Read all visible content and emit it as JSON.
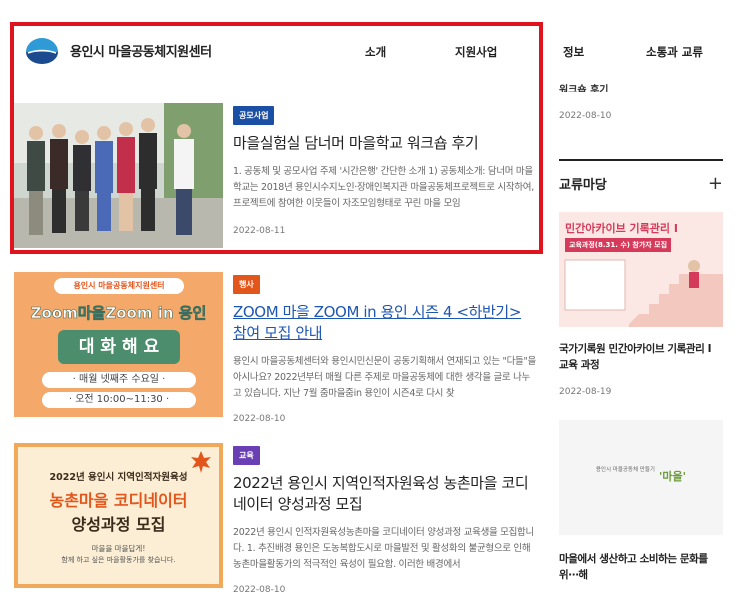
{
  "header": {
    "logo_text": "용인시 마을공동체지원센터",
    "nav": [
      "소개",
      "지원사업",
      "정보",
      "소통과 교류"
    ]
  },
  "articles": [
    {
      "badge": "공모사업",
      "badge_color": "#1a4fa3",
      "title": "마을실험실 담너머 마을학교 워크숍 후기",
      "excerpt": "1. 공동체 및 공모사업 주제 '시간은행' 간단한 소개 1) 공동체소개: 담너머 마을학교는 2018년 용인시수지노인·장애인복지관 마을공동체프로젝트로 시작하여, 프로젝트에 참여한 이웃들이 자조모임형태로 꾸린 마을 모임",
      "date": "2022-08-11"
    },
    {
      "badge": "행사",
      "badge_color": "#e2561b",
      "title": "ZOOM 마을 ZOOM in 용인 시즌 4 <하반기> 참여 모집 안내",
      "excerpt": "용인시 마을공동체센터와 용인시민신문이 공동기획해서 연재되고 있는 \"다들\"을 아시나요? 2022년부터 매월 다른 주제로 마을공동체에 대한 생각을 글로 나누고 있습니다. 지난 7월 줌마을줌in 용인이 시즌4로 다시 찾",
      "date": "2022-08-10",
      "thumb": {
        "top_label": "용인시 마을공동체지원센터",
        "headline": "Zoom마을Zoom in 용인",
        "main": "대 화 해 요",
        "line1": "· 매월 넷째주 수요일 ·",
        "line2": "· 오전 10:00~11:30 ·"
      }
    },
    {
      "badge": "교육",
      "badge_color": "#6a3fb3",
      "title": "2022년 용인시 지역인적자원육성 농촌마을 코디네이터 양성과정 모집",
      "excerpt": "2022년 용인시 인적자원육성농촌마을 코디네이터 양성과정 교육생을 모집합니다. 1. 추진배경 용인은 도농복합도시로 마을발전 및 활성화의 불균형으로 인해 농촌마을활동가의 적극적인 육성이 필요함. 이러한 배경에서",
      "date": "2022-08-10",
      "thumb": {
        "top": "2022년 용인시 지역인적자원육성",
        "line1": "농촌마을 코디네이터",
        "line2": "양성과정 모집",
        "sub1": "마을을 마을답게!",
        "sub2": "함께 하고 싶은 마을활동가를 찾습니다."
      }
    }
  ],
  "sidebar": {
    "top_cut_title": "워크숍 후기",
    "top_date": "2022-08-10",
    "section_title": "교류마당",
    "plus_label": "+",
    "items": [
      {
        "thumb_title": "민간아카이브 기록관리 I",
        "thumb_sub": "교육과정(8.31. 수) 참가자 모집",
        "title": "국가기록원 민간아카이브 기록관리 I 교육 과정",
        "date": "2022-08-19"
      },
      {
        "thumb_small": "용인시 마을공동체 만들기",
        "thumb_word": "'마을'",
        "title": "마을에서 생산하고 소비하는 문화를 위⋯해"
      }
    ]
  }
}
